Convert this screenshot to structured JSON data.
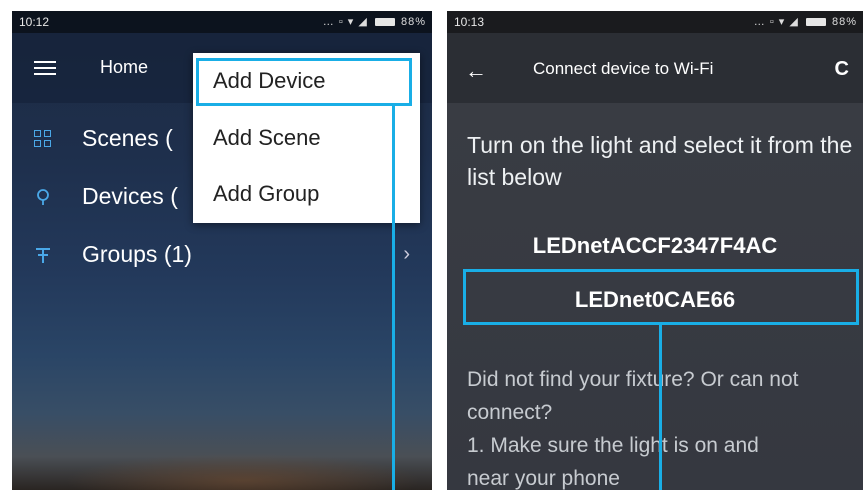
{
  "left_screen": {
    "status_time": "10:12",
    "battery": "88%",
    "toolbar_title": "Home",
    "nav_items": [
      {
        "label": "Scenes (",
        "chevron": ""
      },
      {
        "label": "Devices (",
        "chevron": ""
      },
      {
        "label": "Groups (1)",
        "chevron": "›"
      }
    ],
    "menu_items": [
      "Add Device",
      "Add Scene",
      "Add Group"
    ]
  },
  "right_screen": {
    "status_time": "10:13",
    "battery": "88%",
    "toolbar_title": "Connect device to Wi-Fi",
    "instruction": "Turn on the light and select it from the list below",
    "networks": [
      "LEDnetACCF2347F4AC",
      "LEDnet0CAE66"
    ],
    "help_lines": [
      "Did not find your fixture? Or can not connect?",
      "1. Make sure the light is on and",
      "near your phone"
    ]
  },
  "highlight_color": "#19aee6",
  "icons": {
    "menu": "hamburger-icon",
    "scenes": "scenes-icon",
    "devices": "bulb-icon",
    "groups": "groups-icon",
    "back": "back-arrow-icon",
    "refresh": "refresh-icon"
  }
}
